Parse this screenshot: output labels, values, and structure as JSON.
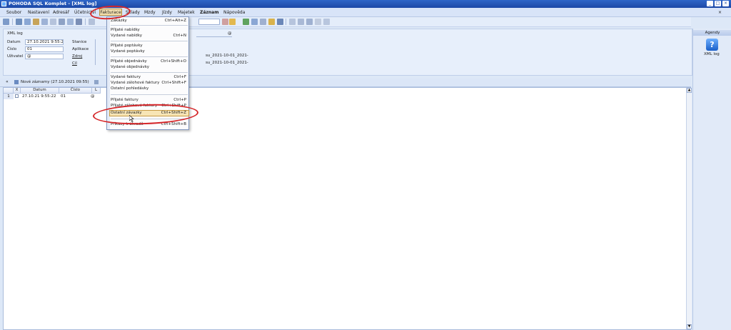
{
  "window": {
    "title": "POHODA SQL Komplet - [XML log]",
    "controls": [
      "_",
      "□",
      "×"
    ]
  },
  "menu": {
    "items": [
      "Soubor",
      "Nastavení",
      "Adresář",
      "Účetnictví",
      "Fakturace",
      "Sklady",
      "Mzdy",
      "Jízdy",
      "Majetek",
      "Záznam",
      "Nápověda"
    ],
    "active": "Fakturace"
  },
  "info": {
    "title": "XML log",
    "datum_label": "Datum",
    "datum_value": "27.10.2021 9:55:2",
    "cislo_label": "Číslo",
    "cislo_value": "01",
    "uzivatel_label": "Uživatel",
    "uzivatel_value": "@",
    "stanice_label": "Stanice",
    "aplikace_label": "Aplikace",
    "zdroj_label": "Zdroj",
    "cil_label": "Cíl",
    "zdroj_value": "su_2021-10-01_2021-",
    "cil_value": "su_2021-10-01_2021-",
    "at_symbol": "@"
  },
  "agenda": {
    "header": "Agendy",
    "item_label": "XML log",
    "item_icon": "?"
  },
  "records": {
    "tab_label": "Nové záznamy (27.10.2021 09:55)",
    "collapse": "«",
    "columns": [
      "X",
      "Datum",
      "Číslo",
      "L"
    ],
    "rows": [
      {
        "marker": "1",
        "datum": "27.10.21 9:55:22",
        "cislo": "01",
        "l": "@"
      }
    ],
    "scroll_up": "▲",
    "scroll_down": "▼"
  },
  "dropdown": {
    "items": [
      {
        "label": "Zakázky",
        "shortcut": "Ctrl+Alt+Z"
      },
      {
        "label": "Přijaté nabídky",
        "shortcut": ""
      },
      {
        "label": "Vydané nabídky",
        "shortcut": "Ctrl+N"
      },
      {
        "label": "Přijaté poptávky",
        "shortcut": ""
      },
      {
        "label": "Vydané poptávky",
        "shortcut": ""
      },
      {
        "label": "Přijaté objednávky",
        "shortcut": "Ctrl+Shift+O"
      },
      {
        "label": "Vydané objednávky",
        "shortcut": ""
      },
      {
        "label": "Vydané faktury",
        "shortcut": "Ctrl+F"
      },
      {
        "label": "Vydané zálohové faktury",
        "shortcut": "Ctrl+Shift+F"
      },
      {
        "label": "Ostatní pohledávky",
        "shortcut": ""
      },
      {
        "label": "Přijaté faktury",
        "shortcut": "Ctrl+P"
      },
      {
        "label": "Přijaté zálohové faktury",
        "shortcut": "Ctrl+Shift+P"
      },
      {
        "label": "Ostatní závazky",
        "shortcut": "Ctrl+Shift+Z"
      },
      {
        "label": "Příkazy k úhradě",
        "shortcut": "Ctrl+Shift+B"
      }
    ],
    "highlighted_index": 12
  }
}
